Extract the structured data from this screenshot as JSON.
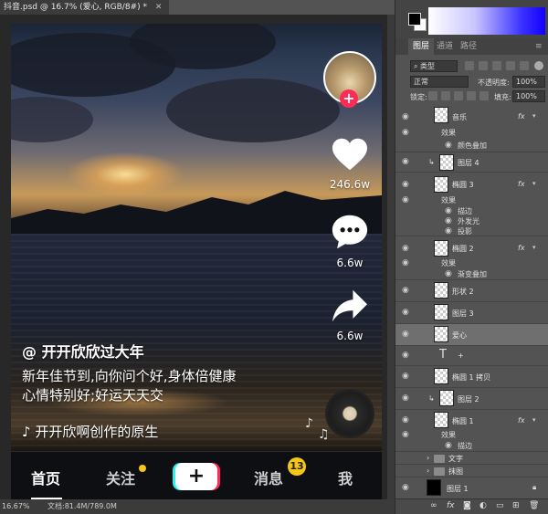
{
  "document": {
    "tab_title": "抖音.psd @ 16.7% (爱心, RGB/8#) *",
    "zoom": "16.67%",
    "doc_info": "文档:81.4M/789.0M"
  },
  "video": {
    "author": "@ 开开欣欣过大年",
    "description_line1": "新年佳节到,向你问个好,身体倍健康",
    "description_line2": "心情特别好;好运天天交",
    "music": "开开欣啊创作的原生",
    "likes": "246.6w",
    "comments": "6.6w",
    "shares": "6.6w",
    "accent": "#fe2c55"
  },
  "nav": {
    "home": "首页",
    "follow": "关注",
    "plus": "+",
    "messages": "消息",
    "messages_badge": "13",
    "me": "我"
  },
  "panel": {
    "tab_layers": "图层",
    "tab_channels": "通道",
    "tab_paths": "路径",
    "filter_kind": "类型",
    "blend_mode": "正常",
    "opacity_label": "不透明度:",
    "opacity_value": "100%",
    "lock_label": "锁定:",
    "fill_label": "填充:",
    "fill_value": "100%"
  },
  "layers": [
    {
      "name": "音乐",
      "fx": "fx",
      "effects_label": "效果",
      "effects": [
        "颜色叠加"
      ]
    },
    {
      "name": "图层 4"
    },
    {
      "name": "椭圆 3",
      "fx": "fx",
      "effects_label": "效果",
      "effects": [
        "描边",
        "外发光",
        "投影"
      ]
    },
    {
      "name": "椭圆 2",
      "fx": "fx",
      "effects_label": "效果",
      "effects": [
        "渐变叠加"
      ]
    },
    {
      "name": "形状 2"
    },
    {
      "name": "图层 3"
    },
    {
      "name": "爱心"
    },
    {
      "name": "+"
    },
    {
      "name": "椭圆 1 拷贝"
    },
    {
      "name": "图层 2"
    },
    {
      "name": "椭圆 1",
      "fx": "fx",
      "effects_label": "效果",
      "effects": [
        "描边"
      ]
    },
    {
      "name": "文字"
    },
    {
      "name": "抹图"
    },
    {
      "name": "图层 1"
    }
  ],
  "footer": {
    "link": "∞",
    "fx": "fx"
  }
}
